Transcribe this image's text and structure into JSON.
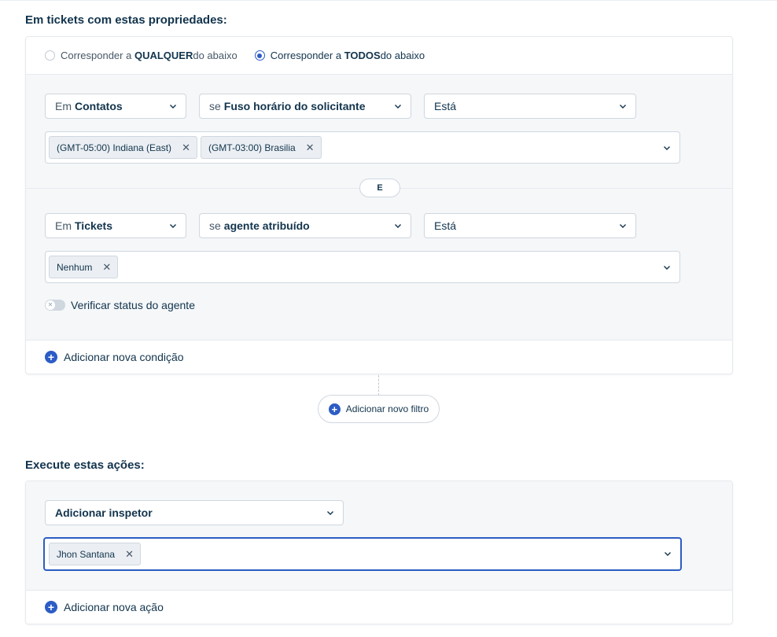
{
  "conditions": {
    "title": "Em tickets com estas propriedades:",
    "match_any": {
      "pre": "Corresponder a ",
      "bold": "QUALQUER",
      "post": " do abaixo",
      "checked": false
    },
    "match_all": {
      "pre": "Corresponder a ",
      "bold": "TODOS",
      "post": " do abaixo",
      "checked": true
    },
    "groups": [
      {
        "entity": {
          "pre": "Em",
          "value": "Contatos"
        },
        "field": {
          "pre": "se",
          "value": "Fuso horário do solicitante"
        },
        "operator": "Está",
        "values": [
          "(GMT-05:00) Indiana (East)",
          "(GMT-03:00) Brasilia"
        ]
      },
      {
        "entity": {
          "pre": "Em",
          "value": "Tickets"
        },
        "field": {
          "pre": "se",
          "value": "agente atribuído"
        },
        "operator": "Está",
        "values": [
          "Nenhum"
        ],
        "toggle": {
          "label": "Verificar status do agente",
          "on": false
        }
      }
    ],
    "connector": "E",
    "add_condition": "Adicionar nova condição",
    "add_filter": "Adicionar novo filtro"
  },
  "actions": {
    "title": "Execute estas ações:",
    "action_select": "Adicionar inspetor",
    "values": [
      "Jhon Santana"
    ],
    "add_action": "Adicionar nova ação"
  },
  "colors": {
    "primary": "#2c5cc5",
    "text": "#12344d",
    "panel": "#f5f7f9",
    "border": "#cfd7df"
  },
  "icons": {
    "dropdown": "chevron-down-icon",
    "remove_chip": "close-icon",
    "add": "plus-circle-icon",
    "toggle_off": "close-icon"
  }
}
